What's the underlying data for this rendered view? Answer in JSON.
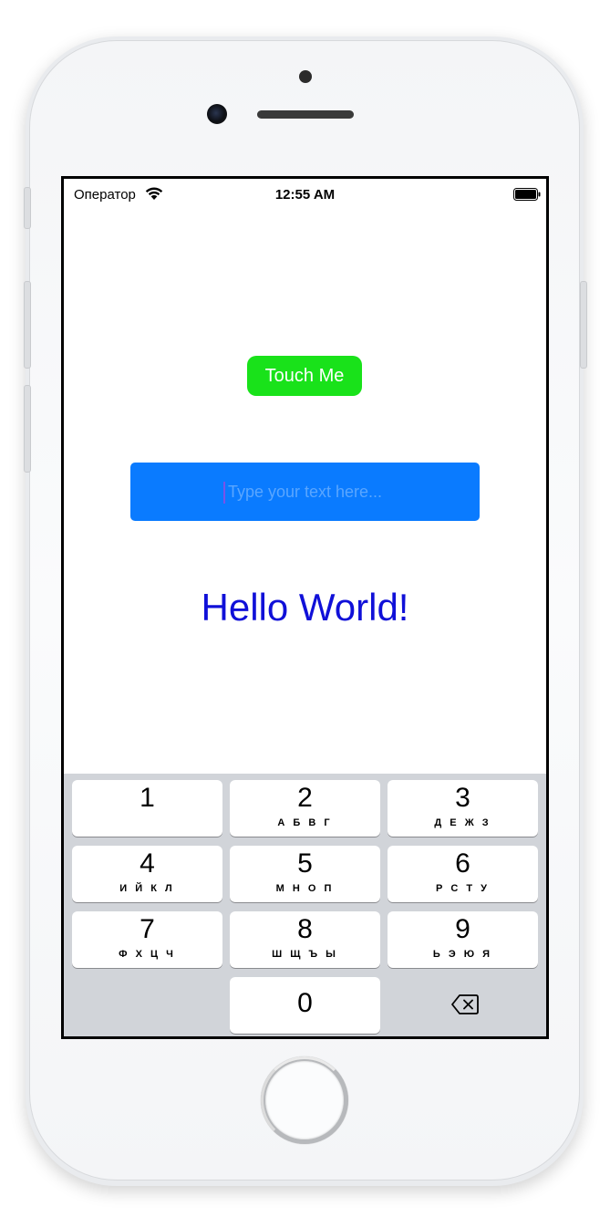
{
  "status_bar": {
    "carrier": "Оператор",
    "time": "12:55 AM"
  },
  "touch_button": {
    "label": "Touch Me",
    "color": "#19e21a"
  },
  "text_field": {
    "value": "",
    "placeholder": "Type your text here...",
    "color": "#0a7bff"
  },
  "hello_label": {
    "text": "Hello World!",
    "color": "#1010d8"
  },
  "keyboard": {
    "keys": [
      {
        "digit": "1",
        "letters": ""
      },
      {
        "digit": "2",
        "letters": "А Б В Г"
      },
      {
        "digit": "3",
        "letters": "Д Е Ж З"
      },
      {
        "digit": "4",
        "letters": "И Й К Л"
      },
      {
        "digit": "5",
        "letters": "М Н О П"
      },
      {
        "digit": "6",
        "letters": "Р С Т У"
      },
      {
        "digit": "7",
        "letters": "Ф Х Ц Ч"
      },
      {
        "digit": "8",
        "letters": "Ш Щ Ъ Ы"
      },
      {
        "digit": "9",
        "letters": "Ь Э Ю Я"
      },
      {
        "digit": "0",
        "letters": ""
      }
    ],
    "delete_icon": "delete-backspace-icon"
  }
}
